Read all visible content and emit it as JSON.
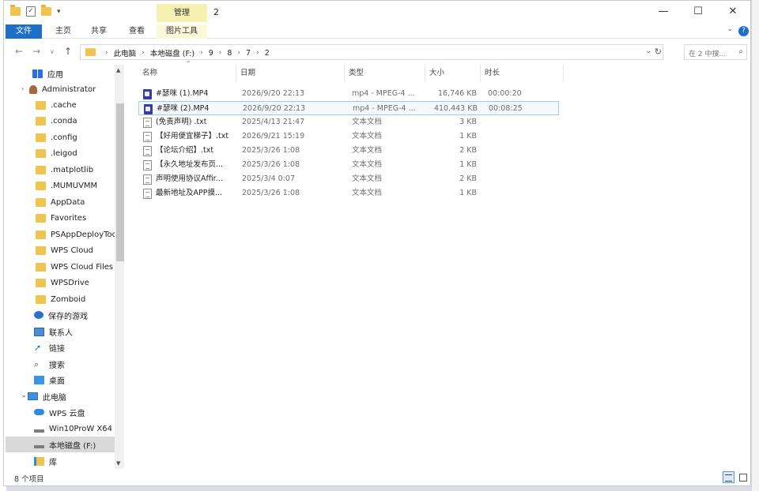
{
  "window": {
    "title": "2",
    "manage_tab": "管理",
    "controls": {
      "minimize": "—",
      "maximize": "☐",
      "close": "✕"
    }
  },
  "ribbon": {
    "tabs": [
      "文件",
      "主页",
      "共享",
      "查看",
      "图片工具"
    ],
    "expand_icon": "chevron-down-icon",
    "help": "?"
  },
  "address": {
    "crumbs": [
      "此电脑",
      "本地磁盘 (F:)",
      "9",
      "8",
      "7",
      "2"
    ],
    "search_placeholder": "在 2 中搜..."
  },
  "nav_pane": {
    "items": [
      {
        "label": "应用",
        "icon": "grid-icon"
      },
      {
        "label": "Administrator",
        "icon": "user-icon"
      },
      {
        "label": ".cache",
        "icon": "folder-icon"
      },
      {
        "label": ".conda",
        "icon": "folder-icon"
      },
      {
        "label": ".config",
        "icon": "folder-icon"
      },
      {
        "label": ".leigod",
        "icon": "folder-icon"
      },
      {
        "label": ".matplotlib",
        "icon": "folder-icon"
      },
      {
        "label": ".MUMUVMM",
        "icon": "folder-icon"
      },
      {
        "label": "AppData",
        "icon": "folder-icon"
      },
      {
        "label": "Favorites",
        "icon": "folder-icon"
      },
      {
        "label": "PSAppDeployToo",
        "icon": "folder-icon"
      },
      {
        "label": "WPS Cloud",
        "icon": "folder-icon"
      },
      {
        "label": "WPS Cloud Files",
        "icon": "folder-icon"
      },
      {
        "label": "WPSDrive",
        "icon": "folder-icon"
      },
      {
        "label": "Zomboid",
        "icon": "folder-icon"
      },
      {
        "label": "保存的游戏",
        "icon": "game-icon"
      },
      {
        "label": "联系人",
        "icon": "contact-icon"
      },
      {
        "label": "链接",
        "icon": "link-icon"
      },
      {
        "label": "搜索",
        "icon": "search-icon"
      },
      {
        "label": "桌面",
        "icon": "desktop-icon"
      },
      {
        "label": "此电脑",
        "icon": "pc-icon"
      },
      {
        "label": "WPS 云盘",
        "icon": "cloud-icon"
      },
      {
        "label": "Win10ProW X64",
        "icon": "drive-icon"
      },
      {
        "label": "本地磁盘 (F:)",
        "icon": "drive-icon"
      },
      {
        "label": "库",
        "icon": "library-icon"
      }
    ]
  },
  "columns": [
    "名称",
    "日期",
    "类型",
    "大小",
    "时长"
  ],
  "files": [
    {
      "name": "#瑟咪 (1).MP4",
      "date": "2026/9/20 22:13",
      "type": "mp4 - MPEG-4 ...",
      "size": "16,746 KB",
      "duration": "00:00:20",
      "icon": "video-icon"
    },
    {
      "name": "#瑟咪 (2).MP4",
      "date": "2026/9/20 22:13",
      "type": "mp4 - MPEG-4 ...",
      "size": "410,443 KB",
      "duration": "00:08:25",
      "icon": "video-icon"
    },
    {
      "name": "(免责声明) .txt",
      "date": "2025/4/13 21:47",
      "type": "文本文档",
      "size": "3 KB",
      "duration": "",
      "icon": "text-file-icon"
    },
    {
      "name": "【好用便宜梯子】.txt",
      "date": "2026/9/21 15:19",
      "type": "文本文档",
      "size": "1 KB",
      "duration": "",
      "icon": "text-file-icon"
    },
    {
      "name": "【论坛介绍】.txt",
      "date": "2025/3/26 1:08",
      "type": "文本文档",
      "size": "2 KB",
      "duration": "",
      "icon": "text-file-icon"
    },
    {
      "name": "【永久地址发布页...",
      "date": "2025/3/26 1:08",
      "type": "文本文档",
      "size": "1 KB",
      "duration": "",
      "icon": "text-file-icon"
    },
    {
      "name": "声明使用协议Affir...",
      "date": "2025/3/4 0:07",
      "type": "文本文档",
      "size": "2 KB",
      "duration": "",
      "icon": "text-file-icon"
    },
    {
      "name": "最新地址及APP摸...",
      "date": "2025/3/26 1:08",
      "type": "文本文档",
      "size": "1 KB",
      "duration": "",
      "icon": "text-file-icon"
    }
  ],
  "status": {
    "text": "8 个项目"
  }
}
